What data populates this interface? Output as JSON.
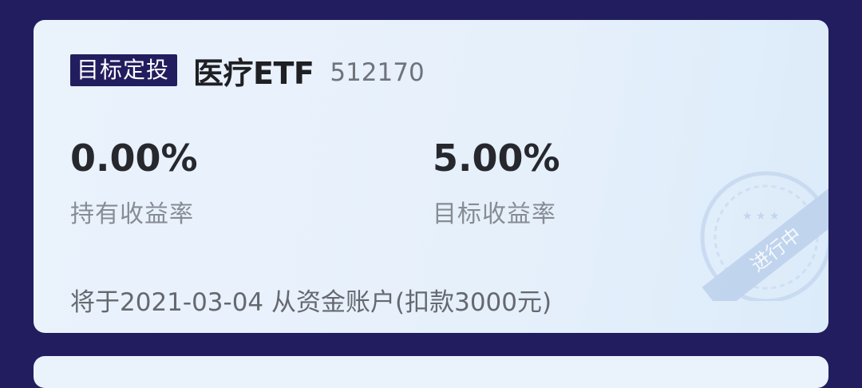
{
  "card": {
    "tag": "目标定投",
    "fund_name": "医疗ETF",
    "fund_code": "512170",
    "holding_return": {
      "value": "0.00%",
      "label": "持有收益率"
    },
    "target_return": {
      "value": "5.00%",
      "label": "目标收益率"
    },
    "footer_text": "将于2021-03-04 从资金账户(扣款3000元)",
    "stamp_text": "进行中"
  },
  "colors": {
    "page_background": "#221d5e",
    "card_background": "#eaf2fc",
    "tag_background": "#221d5e",
    "stamp_color": "#b7cdea"
  }
}
